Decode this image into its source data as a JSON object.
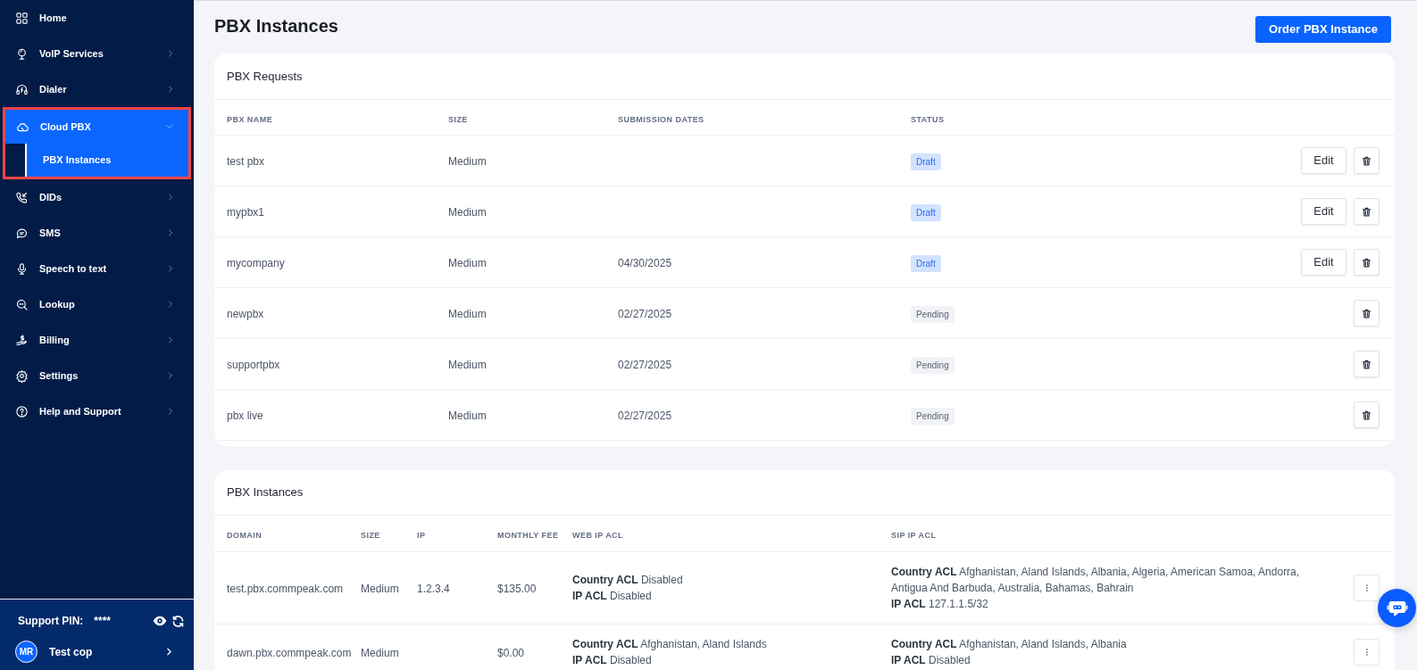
{
  "sidebar": {
    "items": [
      {
        "label": "Home",
        "selected": false,
        "highlighted": false
      },
      {
        "label": "VoIP Services",
        "selected": false,
        "expanded": false,
        "highlighted": false
      },
      {
        "label": "Dialer",
        "selected": false,
        "expanded": false,
        "highlighted": false
      },
      {
        "label": "Cloud PBX",
        "selected": true,
        "expanded": true,
        "highlighted": true,
        "children": [
          {
            "label": "PBX Instances",
            "selected": true
          }
        ]
      },
      {
        "label": "DIDs",
        "selected": false,
        "expanded": false,
        "highlighted": false
      },
      {
        "label": "SMS",
        "selected": false,
        "expanded": false,
        "highlighted": false
      },
      {
        "label": "Speech to text",
        "selected": false,
        "expanded": false,
        "highlighted": false
      },
      {
        "label": "Lookup",
        "selected": false,
        "expanded": false,
        "highlighted": false
      },
      {
        "label": "Billing",
        "selected": false,
        "expanded": false,
        "highlighted": false
      },
      {
        "label": "Settings",
        "selected": false,
        "expanded": false,
        "highlighted": false
      },
      {
        "label": "Help and Support",
        "selected": false,
        "expanded": false,
        "highlighted": false
      }
    ],
    "support_pin": {
      "label": "Support PIN:",
      "value": "****"
    },
    "user": {
      "initials": "MR",
      "name": "Test cop"
    }
  },
  "page": {
    "title": "PBX Instances",
    "primary_button": "Order PBX Instance"
  },
  "requests": {
    "title": "PBX Requests",
    "columns": [
      "PBX NAME",
      "SIZE",
      "SUBMISSION DATES",
      "STATUS"
    ],
    "rows": [
      {
        "name": "test pbx",
        "size": "Medium",
        "status": {
          "label": "Draft",
          "kind": "draft"
        },
        "edit": "Edit"
      },
      {
        "name": "mypbx1",
        "size": "Medium",
        "status": {
          "label": "Draft",
          "kind": "draft"
        },
        "edit": "Edit"
      },
      {
        "name": "mycompany",
        "size": "Medium",
        "date": "04/30/2025",
        "status": {
          "label": "Draft",
          "kind": "draft"
        },
        "edit": "Edit"
      },
      {
        "name": "newpbx",
        "size": "Medium",
        "date": "02/27/2025",
        "status": {
          "label": "Pending",
          "kind": "pending"
        }
      },
      {
        "name": "supportpbx",
        "size": "Medium",
        "date": "02/27/2025",
        "status": {
          "label": "Pending",
          "kind": "pending"
        }
      },
      {
        "name": "pbx live",
        "size": "Medium",
        "date": "02/27/2025",
        "status": {
          "label": "Pending",
          "kind": "pending"
        }
      }
    ]
  },
  "instances": {
    "title": "PBX Instances",
    "columns": [
      "DOMAIN",
      "SIZE",
      "IP",
      "MONTHLY FEE",
      "WEB IP ACL",
      "SIP IP ACL"
    ],
    "rows": [
      {
        "domain": "test.pbx.commpeak.com",
        "size": "Medium",
        "ip": "1.2.3.4",
        "monthly_fee": "$135.00",
        "web_ip_acl": [
          "**Country ACL** Disabled",
          "**IP ACL** Disabled"
        ],
        "sip_ip_acl": [
          "**Country ACL** Afghanistan, Aland Islands, Albania, Algeria, American Samoa, Andorra, Antigua And Barbuda, Australia, Bahamas, Bahrain",
          "**IP ACL** 127.1.1.5/32"
        ]
      },
      {
        "domain": "dawn.pbx.commpeak.com",
        "size": "Medium",
        "monthly_fee": "$0.00",
        "web_ip_acl": [
          "**Country ACL** Afghanistan, Aland Islands",
          "**IP ACL** Disabled"
        ],
        "sip_ip_acl": [
          "**Country ACL** Afghanistan, Aland Islands, Albania",
          "**IP ACL** Disabled"
        ]
      }
    ]
  }
}
